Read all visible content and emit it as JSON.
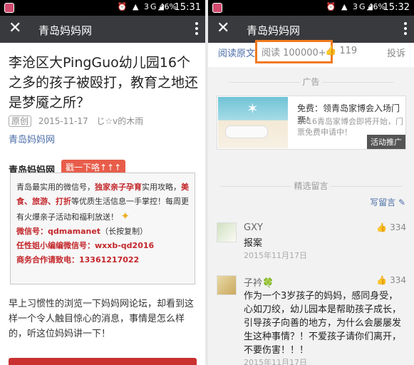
{
  "status_left": {
    "signal": "3G",
    "battery": "46%",
    "time": "15:31"
  },
  "status_right": {
    "signal": "3G",
    "battery": "46%",
    "time": "15:32"
  },
  "titlebar": {
    "title": "青岛妈妈网"
  },
  "article": {
    "title": "李沧区大PingGuo幼儿园16个之多的孩子被殴打，教育之地还是梦魇之所？",
    "original_tag": "原创",
    "date": "2015-11-17",
    "author": "じ☆v的木雨",
    "account": "青岛妈妈网",
    "brand_label": "青岛妈妈网",
    "poke_label": "戳一下咯↑↑↑",
    "card": {
      "p1_a": "青岛最实用的微信号，",
      "p1_b": "独家亲子孕育",
      "p1_c": "实用攻略，",
      "p1_d": "美食、旅游、打折",
      "p1_e": "等优质生活信息一手掌控！每周更有火爆亲子活动和福利放送！",
      "wx_label": "微信号：",
      "wx_value": "qdmamanet",
      "wx_note": "（长按复制）",
      "rx_label": "任性姐小编编微信号：",
      "rx_value": "wxxb-qd2016",
      "biz_label": "商务合作请致电：",
      "biz_value": "13361217022"
    },
    "body": "早上习惯性的浏览一下妈妈网论坛，却看到这样一个令人触目惊心的消息，事情是怎么样的，听这位妈妈讲一下！"
  },
  "stats": {
    "read_original": "阅读原文",
    "reads": "阅读 100000+",
    "likes": "119",
    "report": "投诉"
  },
  "ad_section": {
    "title": "广告",
    "headline": "免费：领青岛家博会入场门票！",
    "desc": "2016青岛家博会即将开始，门票免费申请中！",
    "tag": "活动推广"
  },
  "comments_section": {
    "title": "精选留言",
    "write": "写留言"
  },
  "comments": [
    {
      "name": "GXY",
      "likes": "334",
      "text": "报案",
      "date": "2015年11月17日"
    },
    {
      "name": "子衿🍀",
      "likes": "334",
      "text": "作为一个3岁孩子的妈妈，感同身受，心如刀绞，幼儿园本是帮助孩子成长，引导孩子向善的地方，为什么会屡屡发生这种事情？！不爱孩子请你们离开，不要伤害！！！",
      "date": "2015年11月17日"
    }
  ],
  "icons": [
    "close-icon",
    "more-icon",
    "thumbs-up-icon",
    "pencil-icon",
    "sparkle-icon",
    "clover-icon"
  ],
  "colors": {
    "titlebar": "#393a3e",
    "accent_red": "#c3272b",
    "link_blue": "#4a6da8",
    "highlight_orange": "#f07a1e"
  }
}
